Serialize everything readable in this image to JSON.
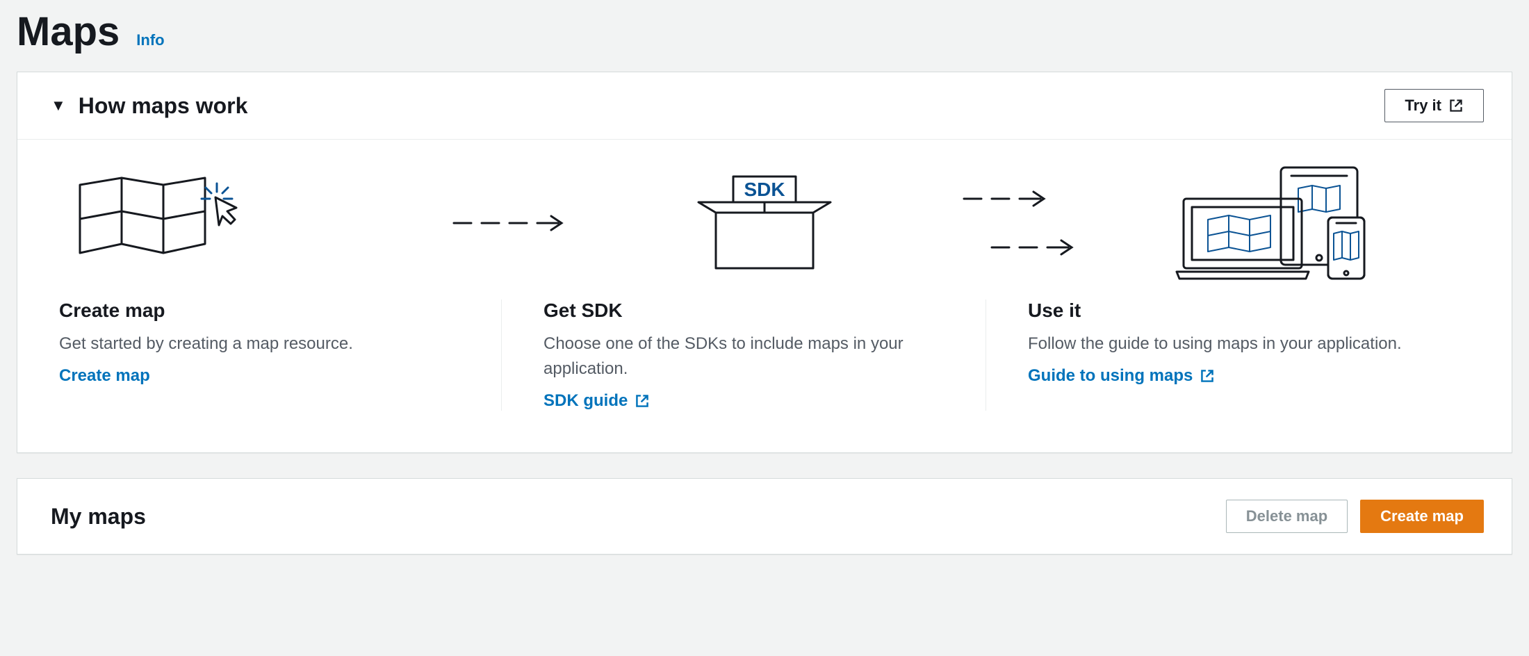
{
  "header": {
    "title": "Maps",
    "info": "Info"
  },
  "howMaps": {
    "title": "How maps work",
    "tryIt": "Try it",
    "steps": [
      {
        "title": "Create map",
        "desc": "Get started by creating a map resource.",
        "link": "Create map"
      },
      {
        "title": "Get SDK",
        "desc": "Choose one of the SDKs to include maps in your application.",
        "link": "SDK guide",
        "sdkLabel": "SDK"
      },
      {
        "title": "Use it",
        "desc": "Follow the guide to using maps in your application.",
        "link": "Guide to using maps"
      }
    ]
  },
  "myMaps": {
    "title": "My maps",
    "delete": "Delete map",
    "create": "Create map"
  }
}
